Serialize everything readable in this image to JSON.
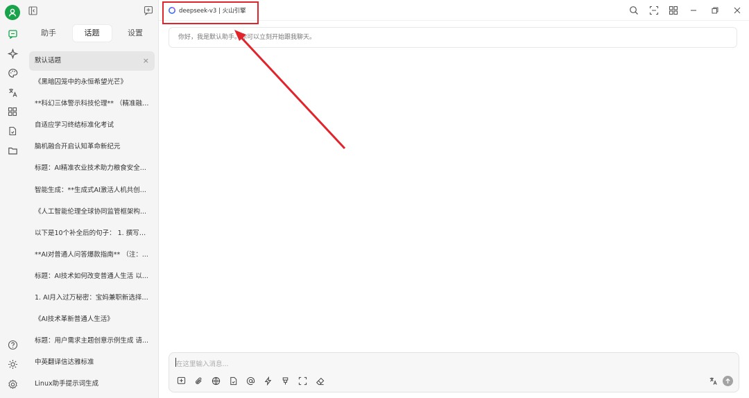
{
  "app": {
    "model_label": "deepseek-v3 | 火山引擎"
  },
  "sidebar": {
    "tabs": [
      {
        "label": "助手"
      },
      {
        "label": "话题"
      },
      {
        "label": "设置"
      }
    ],
    "active_tab": "话题",
    "topics": [
      {
        "label": "默认话题"
      },
      {
        "label": "《黑暗囚笼中的永恒希望光芒》"
      },
      {
        "label": "**科幻三体警示科技伦理** （精准融合..."
      },
      {
        "label": "自适应学习终结标准化考试"
      },
      {
        "label": "脑机融合开启认知革命新纪元"
      },
      {
        "label": "标题：AI精准农业技术助力粮食安全..."
      },
      {
        "label": "智能生成：**生成式AI激活人机共创..."
      },
      {
        "label": "《人工智能伦理全球协同监管框架构..."
      },
      {
        "label": "以下是10个补全后的句子： 1. 撰写一..."
      },
      {
        "label": "**AI对普通人问答爆款指南** （注：..."
      },
      {
        "label": "标题：AI技术如何改变普通人生活 以..."
      },
      {
        "label": "1. AI月入过万秘密：宝妈兼职新选择 ..."
      },
      {
        "label": "《AI技术革新普通人生活》"
      },
      {
        "label": "标题：用户需求主题创意示例生成 请..."
      },
      {
        "label": "中英翻译信达雅标准"
      },
      {
        "label": "Linux助手提示词生成"
      }
    ],
    "close_icon": "×"
  },
  "chat": {
    "greeting": "你好，我是默认助手。你可以立刻开始跟我聊天。"
  },
  "composer": {
    "placeholder": "在这里输入消息..."
  },
  "colors": {
    "accent": "#16a34a",
    "highlight": "#e1242c"
  }
}
